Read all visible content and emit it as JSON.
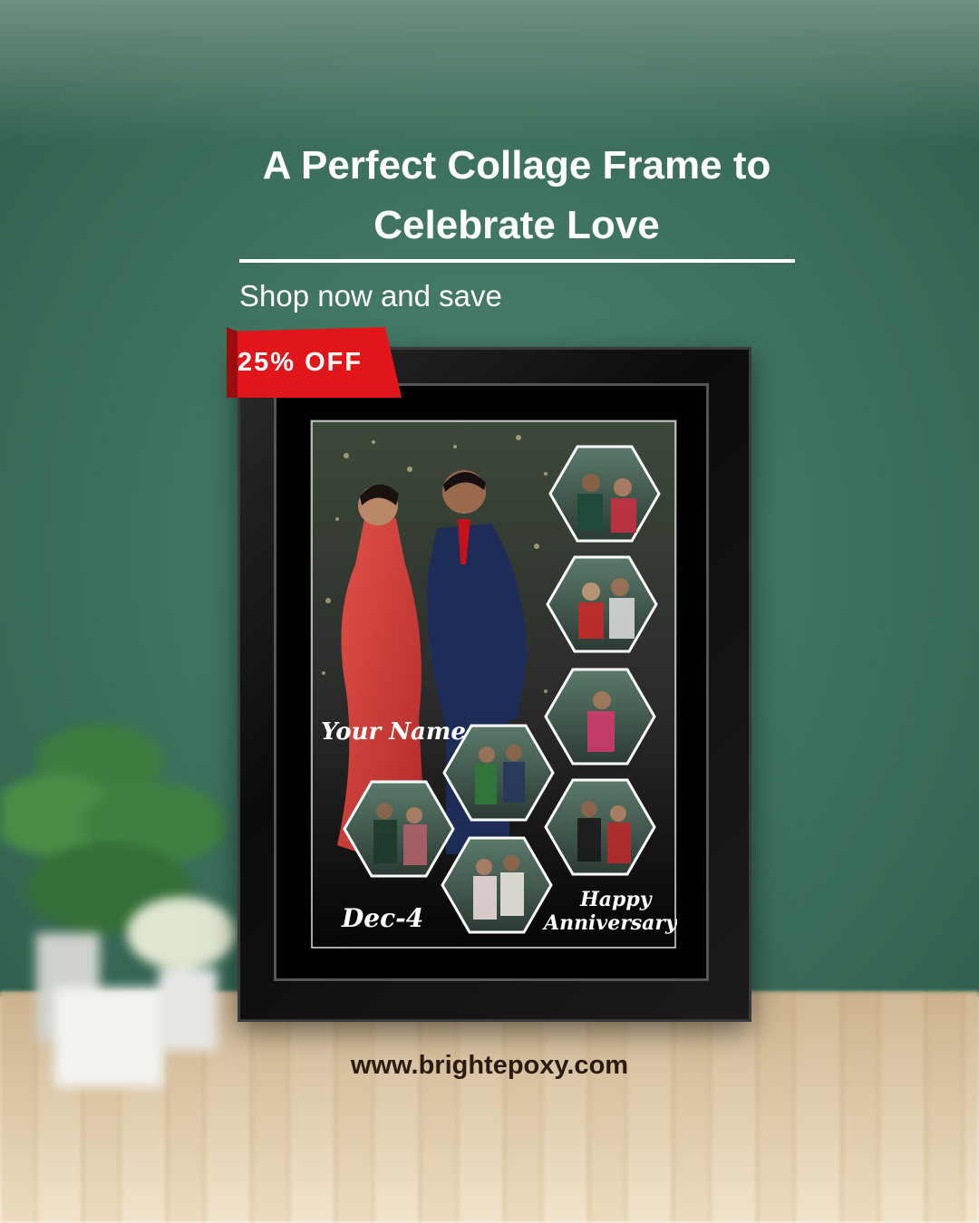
{
  "headline": "A Perfect Collage Frame to Celebrate Love",
  "subhead": "Shop now and save",
  "discount_badge": "25% OFF",
  "website": "www.brightepoxy.com",
  "frame": {
    "name_text": "Your Name",
    "date_text": "Dec-4",
    "occasion_line1": "Happy",
    "occasion_line2": "Anniversary"
  },
  "colors": {
    "wall": "#3f7460",
    "badge": "#e0161b",
    "frame": "#111111",
    "website_text": "#2b1a12"
  }
}
